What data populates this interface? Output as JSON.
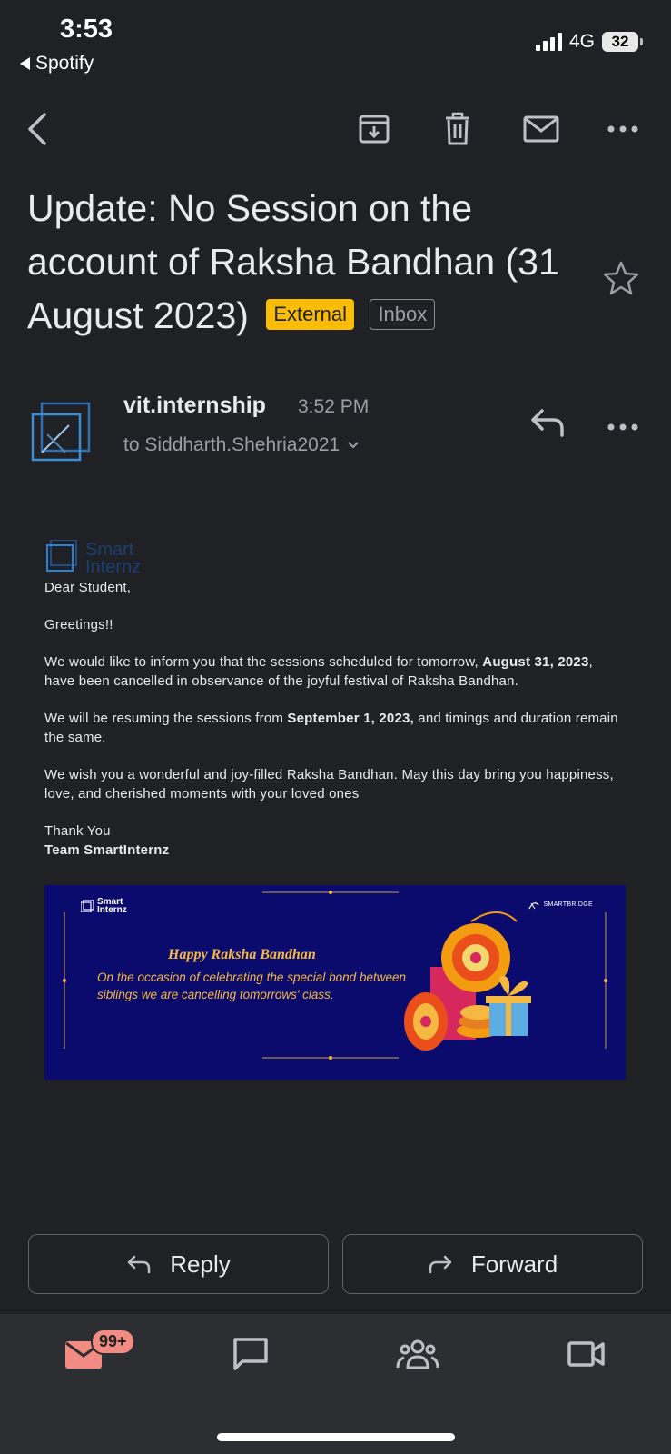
{
  "status": {
    "time": "3:53",
    "back_app": "Spotify",
    "network": "4G",
    "battery": "32"
  },
  "toolbar": {
    "icons": [
      "back-arrow-icon",
      "archive-icon",
      "delete-icon",
      "mark-unread-icon",
      "more-icon"
    ]
  },
  "subject": {
    "text": "Update: No Session on the account of Raksha Bandhan (31 August 2023)",
    "labels": [
      "External",
      "Inbox"
    ]
  },
  "sender": {
    "name": "vit.internship",
    "time": "3:52 PM",
    "to": "to Siddharth.Shehria2021"
  },
  "body": {
    "logo_text": "Smart Internz",
    "greeting": "Dear Student,",
    "greetings": "Greetings!!",
    "p1_a": "We would like to inform you that the sessions scheduled for tomorrow, ",
    "p1_b": "August 31, 2023",
    "p1_c": ", have been cancelled in observance of the joyful festival of Raksha Bandhan.",
    "p2_a": "We will be resuming the sessions from ",
    "p2_b": "September 1, 2023,",
    "p2_c": " and timings and duration remain the same.",
    "p3": "We wish you a wonderful and joy-filled Raksha Bandhan. May this day bring you happiness, love, and cherished moments with your loved ones",
    "thanks": "Thank You",
    "team": "Team SmartInternz"
  },
  "banner": {
    "brand_top": "Smart",
    "brand_bottom": "Internz",
    "brand_right": "SMARTBRIDGE",
    "title": "Happy Raksha Bandhan",
    "text": "On the occasion of celebrating the special bond between siblings we are cancelling tomorrows' class.",
    "colors": {
      "background": "#0b0b6e",
      "text": "#f5b942"
    }
  },
  "actions": {
    "reply": "Reply",
    "forward": "Forward"
  },
  "bottom_nav": {
    "mail_badge": "99+",
    "items": [
      "mail-icon",
      "chat-icon",
      "spaces-icon",
      "meet-icon"
    ]
  },
  "colors": {
    "background": "#202124",
    "external_label": "#fbbc04",
    "badge": "#f28b82"
  }
}
